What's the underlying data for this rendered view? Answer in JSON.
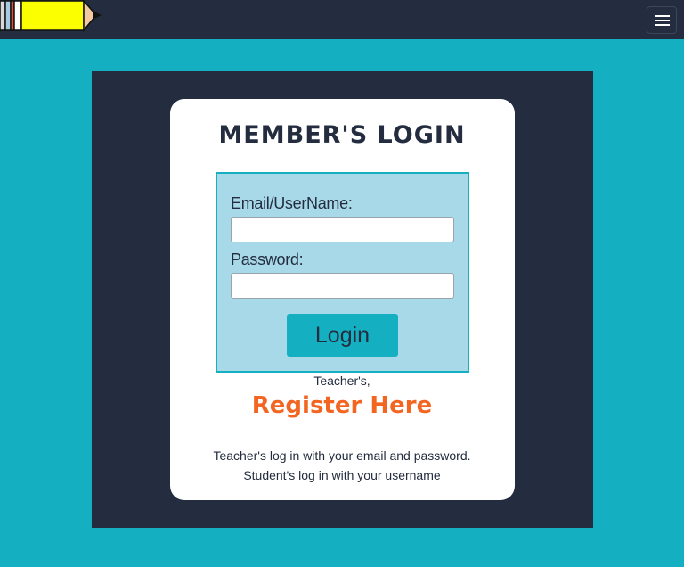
{
  "colors": {
    "background": "#14b0c1",
    "navbar": "#232d3f",
    "panel": "#232d3f",
    "card": "#ffffff",
    "form_box": "#a8d9e8",
    "accent": "#14b0c1",
    "register_link": "#f26622",
    "text": "#232d3f"
  },
  "header": {
    "logo_icon": "pencil-logo-icon",
    "menu_icon": "hamburger-menu-icon"
  },
  "login": {
    "title": "MEMBER'S LOGIN",
    "email_label": "Email/UserName:",
    "email_value": "",
    "password_label": "Password:",
    "password_value": "",
    "submit_label": "Login"
  },
  "register": {
    "prompt": "Teacher's,",
    "link_label": "Register Here"
  },
  "info": {
    "line1": "Teacher's log in with your email and password.",
    "line2": "Student's log in with your username"
  }
}
